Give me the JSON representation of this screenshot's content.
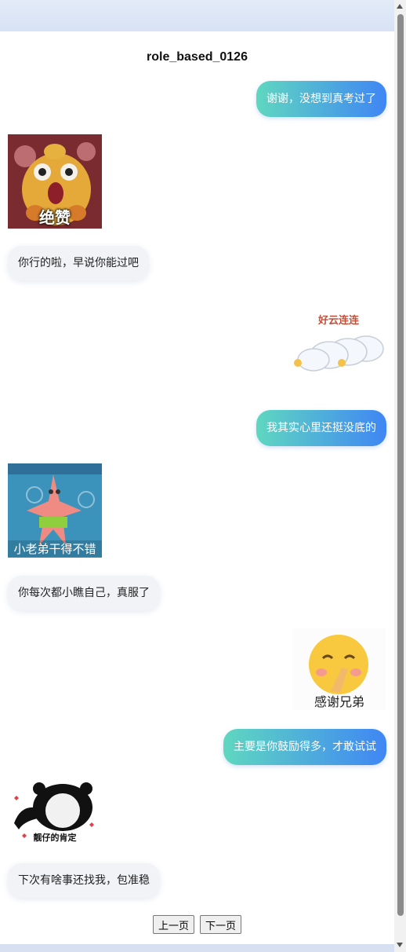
{
  "page": {
    "title": "role_based_0126"
  },
  "messages": [
    {
      "side": "out",
      "text": "谢谢，没想到真考过了"
    },
    {
      "side": "in",
      "sticker_caption": "绝赞"
    },
    {
      "side": "in",
      "text": "你行的啦，早说你能过吧"
    },
    {
      "side": "out",
      "sticker_caption": "好云连连"
    },
    {
      "side": "out",
      "text": "我其实心里还挺没底的"
    },
    {
      "side": "in",
      "sticker_caption": "小老弟干得不错"
    },
    {
      "side": "in",
      "text": "你每次都小瞧自己，真服了"
    },
    {
      "side": "out",
      "sticker_caption": "感谢兄弟"
    },
    {
      "side": "out",
      "text": "主要是你鼓励得多，才敢试试"
    },
    {
      "side": "in",
      "sticker_caption": "靓仔的肯定"
    },
    {
      "side": "in",
      "text": "下次有啥事还找我，包准稳"
    }
  ],
  "pager": {
    "prev": "上一页",
    "next": "下一页"
  }
}
